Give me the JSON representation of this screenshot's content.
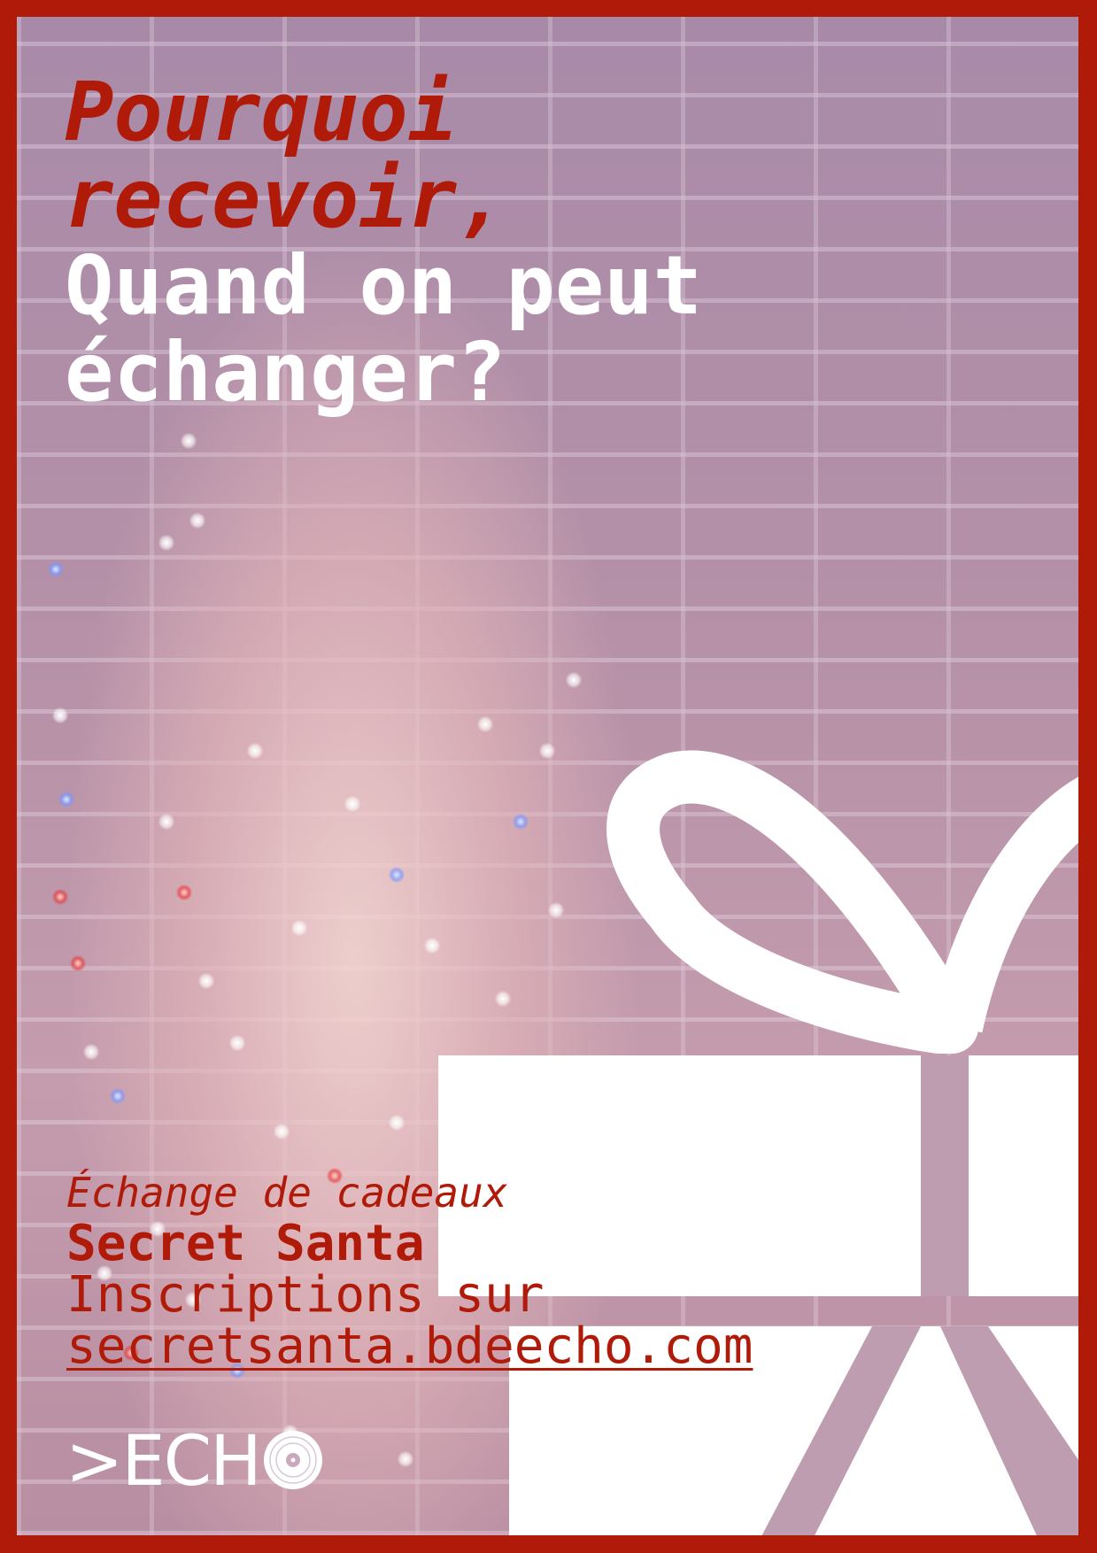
{
  "headline": {
    "line1": "Pourquoi",
    "line2": "recevoir,",
    "line3": "Quand on peut",
    "line4": "échanger?"
  },
  "event": {
    "subtitle": "Échange de cadeaux",
    "name": "Secret Santa",
    "signup_text": "Inscriptions sur",
    "signup_url": "secretsanta.bdeecho.com"
  },
  "logo": {
    "text": ">ECH",
    "icon": "vinyl-disc-icon"
  },
  "colors": {
    "accent": "#b01a08",
    "highlight": "#ffffff"
  },
  "graphics": {
    "gift_icon": "gift-box-icon",
    "photo": "man-wrapped-in-christmas-lights"
  }
}
